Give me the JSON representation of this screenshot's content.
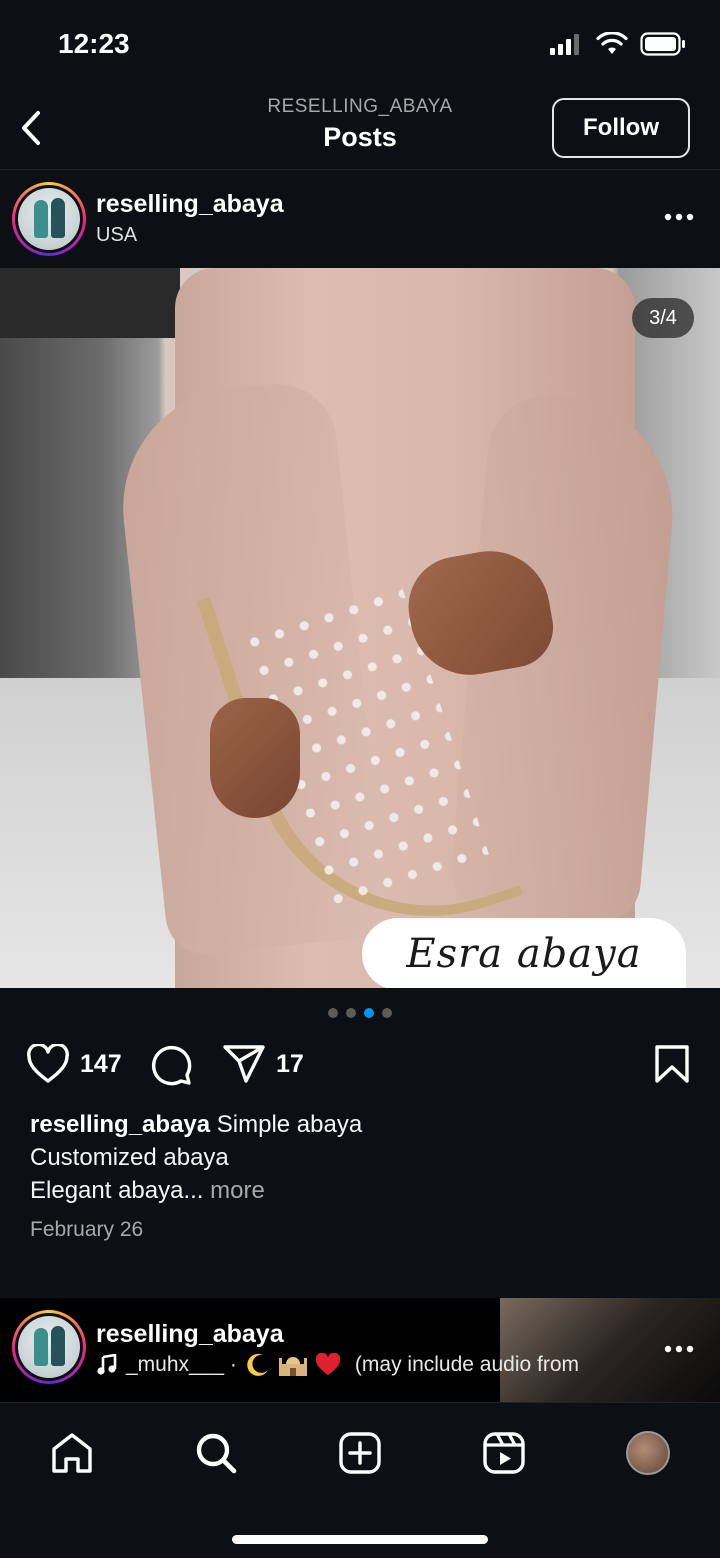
{
  "status_bar": {
    "time": "12:23"
  },
  "header": {
    "subtitle": "RESELLING_ABAYA",
    "title": "Posts",
    "follow_label": "Follow"
  },
  "post": {
    "username": "reselling_abaya",
    "location": "USA",
    "image_counter": "3/4",
    "image_label": "Esra abaya",
    "carousel": {
      "total": 4,
      "active_index": 2
    },
    "likes": "147",
    "shares": "17",
    "caption_username": "reselling_abaya",
    "caption_lines": [
      "Simple abaya",
      "Customized abaya",
      "Elegant abaya..."
    ],
    "more_label": "more",
    "date": "February 26"
  },
  "next_post": {
    "username": "reselling_abaya",
    "audio_user": "_muhx___ ·",
    "audio_suffix": "(may include audio from"
  },
  "icons": {
    "back": "chevron-left-icon",
    "more": "more-horizontal-icon",
    "like": "heart-icon",
    "comment": "comment-icon",
    "share": "send-icon",
    "save": "bookmark-icon",
    "music": "music-note-icon",
    "tabs": [
      "home-icon",
      "search-icon",
      "create-icon",
      "reels-icon",
      "profile-avatar"
    ]
  },
  "colors": {
    "background": "#0c1014",
    "accent": "#0095f6",
    "heart": "#e0202f"
  }
}
